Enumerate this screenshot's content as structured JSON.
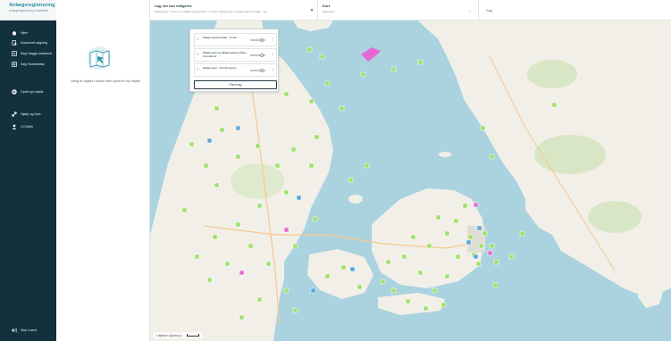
{
  "app": {
    "title": "Anlægsregistrering",
    "subtitle": "Anlægsregistrering & aktiviteter"
  },
  "sidebar": {
    "items": [
      {
        "label": "Hjem",
        "icon": "home-icon"
      },
      {
        "label": "Avanceret søgning",
        "icon": "document-search-icon"
      },
      {
        "label": "Søg i bagge anlæsset",
        "icon": "list-search-icon"
      },
      {
        "label": "Søg i fiskestdata",
        "icon": "dataset-search-icon"
      },
      {
        "label": "Opret nyt objekt",
        "icon": "plus-circle-icon"
      },
      {
        "label": "Hjælp og links",
        "icon": "link-icon"
      },
      {
        "label": "CCVidrik",
        "icon": "user-icon"
      }
    ],
    "logout": {
      "label": "Skip Lorent",
      "icon": "logout-icon"
    }
  },
  "info_panel": {
    "text": "Vælg et objekt i kortet eller opret et nyt objekt"
  },
  "topbar": {
    "layer_tab": {
      "title": "Lag, der kan redigeres",
      "subtitle": "Miljøprojekt - Punkt og / Miljøprojektområdet - Projekt, Miljøprojekt og Miljøprojektområdet - Ro..."
    },
    "map_tab": {
      "title": "Kort",
      "subtitle": "Baselabel"
    },
    "search": {
      "placeholder": "Søg"
    }
  },
  "layer_panel": {
    "layers": [
      {
        "name": "Miljøprojektområdet - Punkt"
      },
      {
        "name": "Miljøprojekt og Miljøprojektområdet - Grundpoint"
      },
      {
        "name": "Miljøprojekt - Plan/Program"
      }
    ],
    "more_button": "Flere lag"
  },
  "map": {
    "scale_text": "1:680647 ±@2021 j≥",
    "colors": {
      "water": "#aad3df",
      "land": "#f2efe9",
      "forest": "#cfe3b6",
      "marker_green": "#9fe06b",
      "marker_blue": "#5aa8d8",
      "marker_pink": "#e56ad6"
    }
  }
}
